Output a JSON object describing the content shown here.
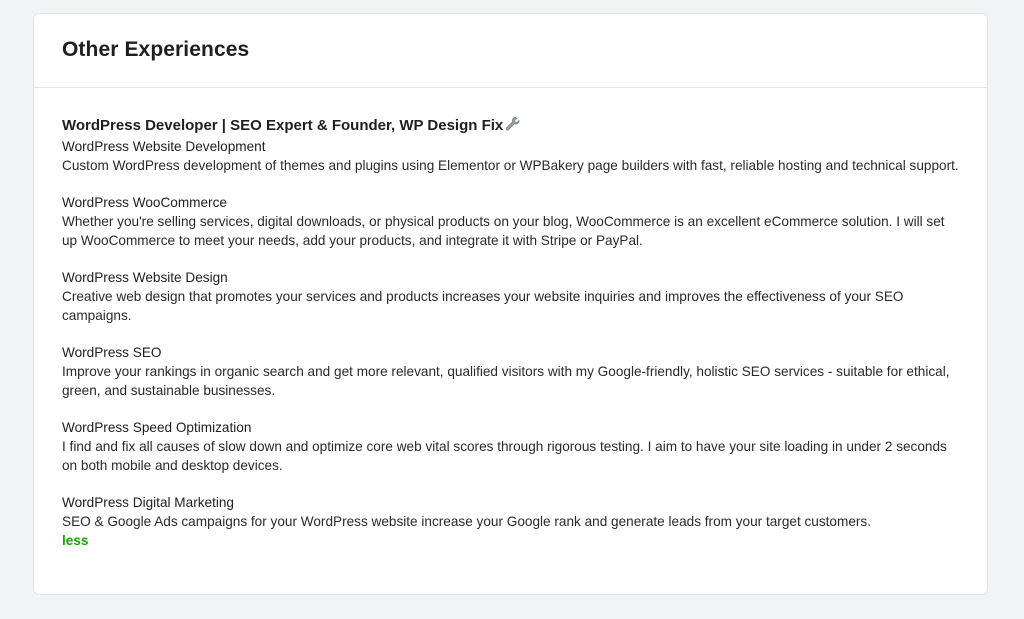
{
  "card": {
    "title": "Other Experiences",
    "job_title": "WordPress Developer | SEO Expert & Founder, WP Design Fix",
    "job_icon": "wrench-icon",
    "sections": [
      {
        "title": "WordPress Website Development",
        "description": "Custom WordPress development of themes and plugins using Elementor or WPBakery page builders with fast, reliable hosting and technical support."
      },
      {
        "title": "WordPress WooCommerce",
        "description": "Whether you're selling services, digital downloads, or physical products on your blog, WooCommerce is an excellent eCommerce solution. I will set up WooCommerce to meet your needs, add your products, and integrate it with Stripe or PayPal."
      },
      {
        "title": "WordPress Website Design",
        "description": "Creative web design that promotes your services and products increases your website inquiries and improves the effectiveness of your SEO campaigns."
      },
      {
        "title": "WordPress SEO",
        "description": "Improve your rankings in organic search and get more relevant, qualified visitors with my Google-friendly, holistic SEO services - suitable for ethical, green, and sustainable businesses."
      },
      {
        "title": "WordPress Speed Optimization",
        "description": "I find and fix all causes of slow down and optimize core web vital scores through rigorous testing. I aim to have your site loading in under 2 seconds on both mobile and desktop devices."
      },
      {
        "title": "WordPress Digital Marketing",
        "description": "SEO & Google Ads campaigns for your WordPress website increase your Google rank and generate leads from your target customers."
      }
    ],
    "less_label": "less"
  },
  "colors": {
    "accent": "#14a800",
    "background": "#f2f3f5",
    "card": "#ffffff",
    "border": "#e1e3e6"
  }
}
